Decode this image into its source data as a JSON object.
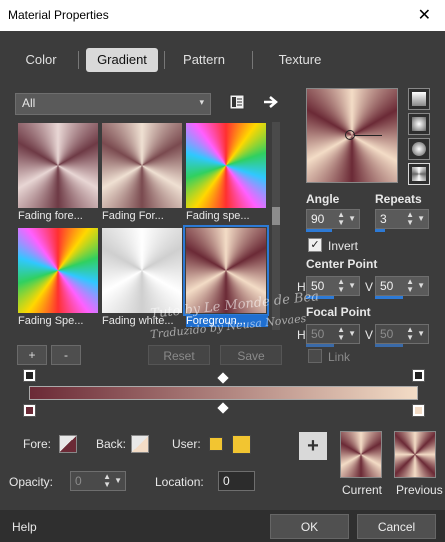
{
  "window": {
    "title": "Material Properties",
    "close_glyph": "✕"
  },
  "tabs": [
    "Color",
    "Gradient",
    "Pattern",
    "Texture"
  ],
  "active_tab": "Gradient",
  "category": {
    "value": "All",
    "arrow": "▾"
  },
  "icons": {
    "library": "library-icon",
    "more": "arrow-right-icon"
  },
  "gradients": [
    {
      "label": "Fading fore...",
      "selected": false
    },
    {
      "label": "Fading For...",
      "selected": false
    },
    {
      "label": "Fading spe...",
      "selected": false
    },
    {
      "label": "Fading Spe...",
      "selected": false
    },
    {
      "label": "Fading white...",
      "selected": false
    },
    {
      "label": "Foregroun...",
      "selected": true
    }
  ],
  "gallery_buttons": {
    "add": "+",
    "remove": "-",
    "reset": "Reset",
    "save": "Save"
  },
  "props": {
    "angle_label": "Angle",
    "angle_value": "90",
    "repeats_label": "Repeats",
    "repeats_value": "3",
    "invert_label": "Invert",
    "invert_checked": true,
    "check_glyph": "✓",
    "center_label": "Center Point",
    "center_h": "50",
    "center_v": "50",
    "focal_label": "Focal Point",
    "focal_h": "50",
    "focal_v": "50",
    "h": "H",
    "v": "V",
    "link_label": "Link"
  },
  "editor": {
    "fore_label": "Fore:",
    "back_label": "Back:",
    "user_label": "User:",
    "opacity_label": "Opacity:",
    "opacity_value": "0",
    "location_label": "Location:",
    "location_value": "0"
  },
  "swatches": {
    "current_label": "Current",
    "previous_label": "Previous",
    "plus_glyph": "+"
  },
  "footer": {
    "help": "Help",
    "ok": "OK",
    "cancel": "Cancel"
  },
  "watermark": {
    "line1": "Tuto by Le Monde de Bea",
    "line2": "Traduzido by Neusa Novaes"
  },
  "colors": {
    "accent": "#2d7ad6",
    "foreground": "#6b2a36",
    "background": "#f3dcc6",
    "user": "#f2c531"
  },
  "spin_glyphs": {
    "up": "▲",
    "down": "▼",
    "drop": "▼"
  }
}
